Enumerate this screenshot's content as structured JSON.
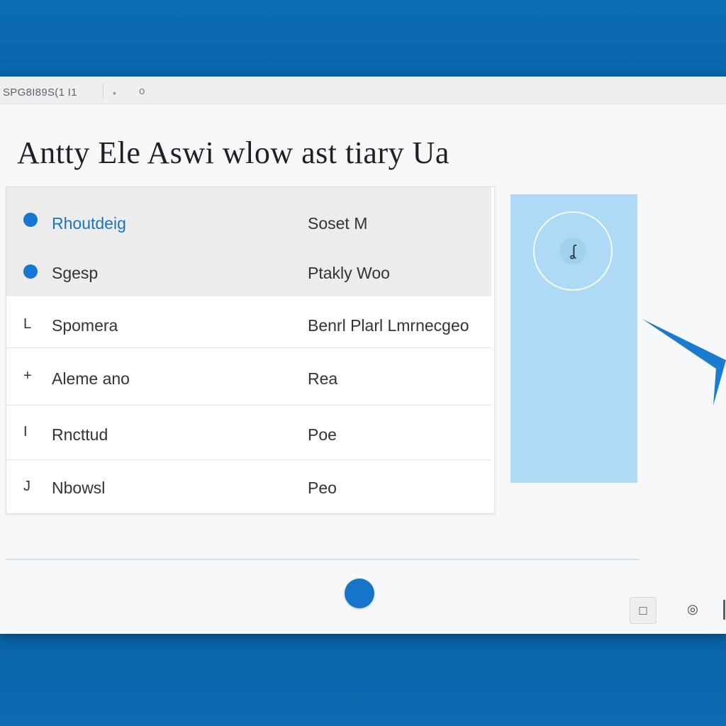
{
  "window": {
    "app_title": "SPG8I89S(1 I1",
    "title_dot": "•",
    "title_circle": "o"
  },
  "page": {
    "heading": "Antty Ele Aswi wlow ast tiary Ua"
  },
  "table": {
    "rows": [
      {
        "marker": "",
        "name": "Rhoutdeig",
        "value": "Soset M",
        "style": "bullet",
        "active": true
      },
      {
        "marker": "",
        "name": "Sgesp",
        "value": "Ptakly Woo",
        "style": "bullet",
        "active": false
      },
      {
        "marker": "L",
        "name": "Spomera",
        "value": "Benrl Plarl Lmrnecgeo",
        "style": "text",
        "active": false
      },
      {
        "marker": "+",
        "name": "Aleme ano",
        "value": "Rea",
        "style": "text",
        "active": false
      },
      {
        "marker": "I",
        "name": "Rncttud",
        "value": "Poe",
        "style": "text",
        "active": false
      },
      {
        "marker": "J",
        "name": "Nbowsl",
        "value": "Peo",
        "style": "text",
        "active": false
      }
    ]
  },
  "side_panel": {
    "badge_glyph": "ʆ",
    "ring_icon": "circle-badge-icon"
  },
  "toolbar": {
    "square_glyph": "□",
    "round_glyph": "◎"
  },
  "colors": {
    "accent": "#1674c9",
    "background_band": "#0b6cb4",
    "side_panel": "#aedaf6",
    "active_text": "#1575c7"
  }
}
